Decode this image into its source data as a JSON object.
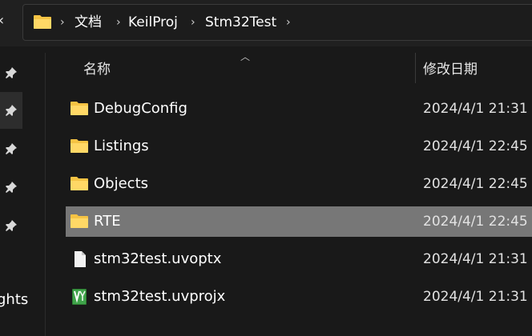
{
  "address": {
    "breadcrumbs": [
      "文档",
      "KeilProj",
      "Stm32Test"
    ],
    "separator": "›"
  },
  "columns": {
    "name": "名称",
    "date_modified": "修改日期"
  },
  "sidebar": {
    "partial_label": "ghts"
  },
  "files": [
    {
      "name": "DebugConfig",
      "date": "2024/4/1 21:31",
      "type": "folder",
      "selected": false
    },
    {
      "name": "Listings",
      "date": "2024/4/1 22:45",
      "type": "folder",
      "selected": false
    },
    {
      "name": "Objects",
      "date": "2024/4/1 22:45",
      "type": "folder",
      "selected": false
    },
    {
      "name": "RTE",
      "date": "2024/4/1 22:45",
      "type": "folder",
      "selected": true
    },
    {
      "name": "stm32test.uvoptx",
      "date": "2024/4/1 21:31",
      "type": "file",
      "selected": false
    },
    {
      "name": "stm32test.uvprojx",
      "date": "2024/4/1 21:31",
      "type": "keil-project",
      "selected": false
    }
  ],
  "icons": {
    "folder": "folder-icon",
    "file": "document-icon",
    "keil-project": "keil-project-icon",
    "pin": "pin-icon"
  },
  "colors": {
    "folder": "#f5c344",
    "selection": "#777777",
    "background": "#191919"
  }
}
